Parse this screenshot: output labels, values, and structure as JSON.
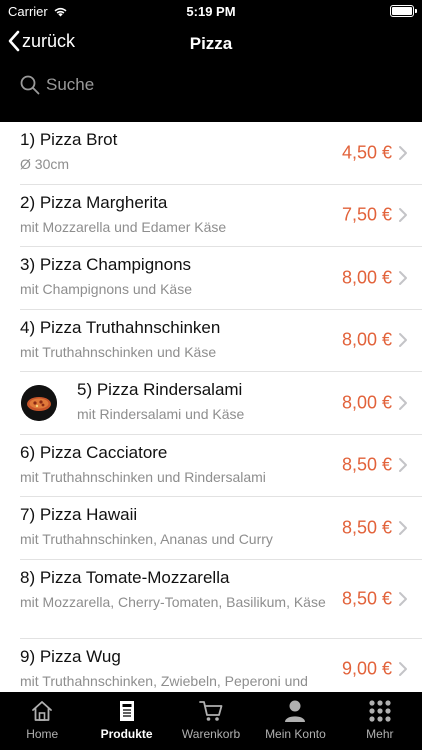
{
  "status": {
    "carrier": "Carrier",
    "time": "5:19 PM"
  },
  "nav": {
    "back_label": "zurück",
    "title": "Pizza"
  },
  "search": {
    "placeholder": "Suche"
  },
  "products": [
    {
      "name": "1) Pizza Brot",
      "desc": "Ø 30cm",
      "price": "4,50 €"
    },
    {
      "name": "2) Pizza Margherita",
      "desc": "mit Mozzarella und Edamer Käse",
      "price": "7,50 €"
    },
    {
      "name": "3) Pizza Champignons",
      "desc": "mit Champignons und Käse",
      "price": "8,00 €"
    },
    {
      "name": "4) Pizza Truthahnschinken",
      "desc": "mit Truthahnschinken und Käse",
      "price": "8,00 €"
    },
    {
      "name": "5) Pizza Rindersalami",
      "desc": "mit Rindersalami und Käse",
      "price": "8,00 €",
      "has_image": true
    },
    {
      "name": "6) Pizza Cacciatore",
      "desc": "mit Truthahnschinken und Rindersalami",
      "price": "8,50 €"
    },
    {
      "name": "7) Pizza Hawaii",
      "desc": "mit Truthahnschinken, Ananas und Curry",
      "price": "8,50 €"
    },
    {
      "name": "8) Pizza Tomate-Mozzarella",
      "desc": "mit Mozzarella, Cherry-Tomaten, Basilikum, Käse",
      "price": "8,50 €"
    },
    {
      "name": "9) Pizza Wug",
      "desc": "mit Truthahnschinken, Zwiebeln, Peperoni und",
      "price": "9,00 €"
    }
  ],
  "tabs": [
    {
      "label": "Home",
      "icon": "home-icon",
      "active": false
    },
    {
      "label": "Produkte",
      "icon": "menu-card-icon",
      "active": true
    },
    {
      "label": "Warenkorb",
      "icon": "cart-icon",
      "active": false
    },
    {
      "label": "Mein Konto",
      "icon": "user-icon",
      "active": false
    },
    {
      "label": "Mehr",
      "icon": "grid-dots-icon",
      "active": false
    }
  ],
  "colors": {
    "accent_price": "#e2623a",
    "bar_background": "#000000",
    "description_gray": "#8e8e8e"
  }
}
